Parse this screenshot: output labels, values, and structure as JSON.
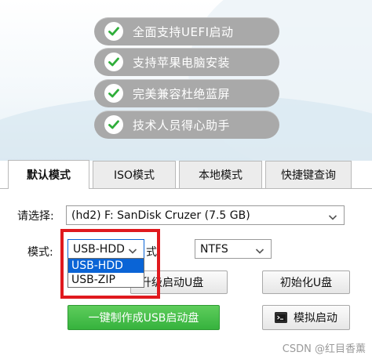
{
  "features": [
    {
      "text": "全面支持UEFI启动",
      "icon": "check-icon"
    },
    {
      "text": "支持苹果电脑安装",
      "icon": "check-icon"
    },
    {
      "text": "完美兼容杜绝蓝屏",
      "icon": "check-icon"
    },
    {
      "text": "技术人员得心助手",
      "icon": "check-icon"
    }
  ],
  "tabs": [
    {
      "label": "默认模式",
      "active": true
    },
    {
      "label": "ISO模式",
      "active": false
    },
    {
      "label": "本地模式",
      "active": false
    },
    {
      "label": "快捷键查询",
      "active": false
    }
  ],
  "form": {
    "device_label": "请选择:",
    "device_value": "(hd2) F: SanDisk Cruzer (7.5 GB)",
    "mode_label": "模式:",
    "mode_value": "USB-HDD",
    "mode_options": [
      "USB-HDD",
      "USB-ZIP"
    ],
    "format_label": "格式:",
    "format_label_visible": "格式:",
    "format_value": "NTFS"
  },
  "buttons": {
    "upgrade_label": "升级启动U盘",
    "upgrade_label_visible": "升级启动U盘",
    "init_label": "初始化U盘",
    "make_label": "一键制作成USB启动盘",
    "simulate_label": "模拟启动"
  },
  "watermark": "CSDN @红目香薰",
  "colors": {
    "accent_green": "#36b23d",
    "highlight_red": "#e0191e",
    "selection_blue": "#0a64d6",
    "feature_pill": "#a9a9a9"
  }
}
